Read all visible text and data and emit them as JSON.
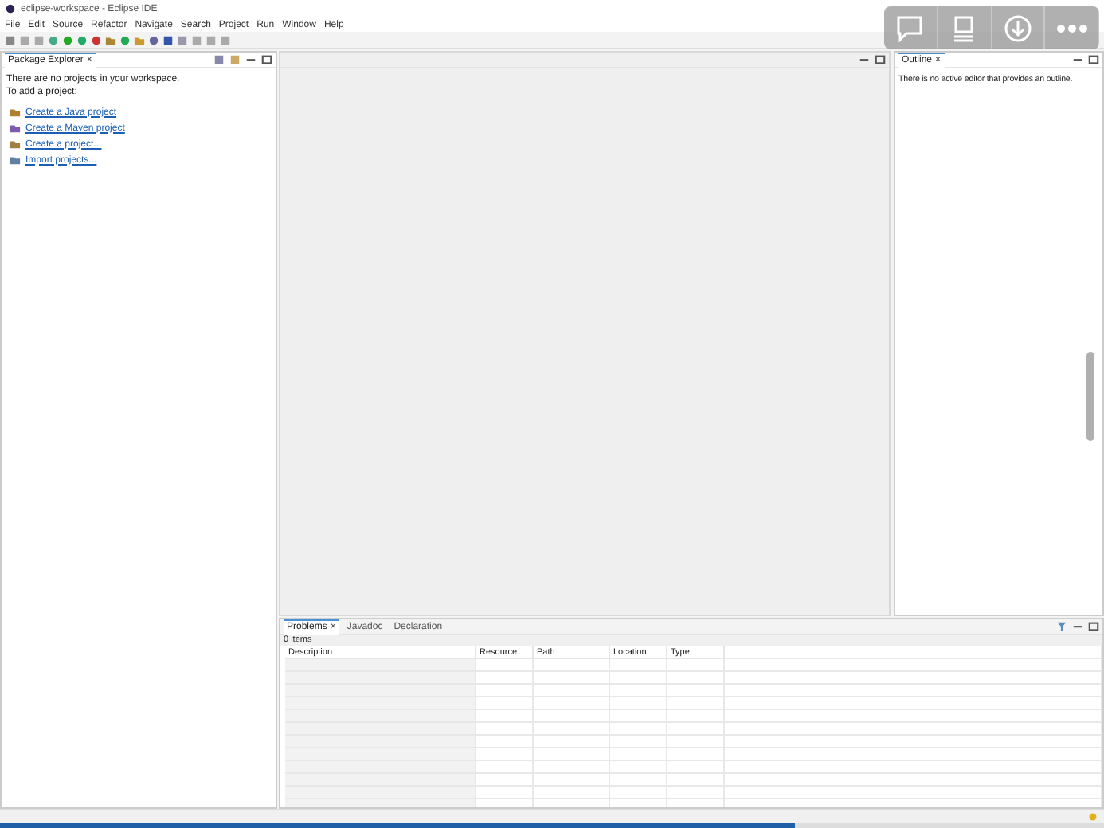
{
  "window": {
    "title": "eclipse-workspace - Eclipse IDE"
  },
  "menu": [
    "File",
    "Edit",
    "Source",
    "Refactor",
    "Navigate",
    "Search",
    "Project",
    "Run",
    "Window",
    "Help"
  ],
  "package_explorer": {
    "tab": "Package Explorer",
    "close": "×",
    "message": [
      "There are no projects in your workspace.",
      "To add a project:"
    ],
    "links": [
      "Create a Java project",
      "Create a Maven project",
      "Create a project...",
      "Import projects..."
    ]
  },
  "outline": {
    "tab": "Outline",
    "close": "×",
    "message": "There is no active editor that provides an outline."
  },
  "bottom_panel": {
    "tabs": [
      {
        "label": "Problems",
        "selected": true,
        "close": "×"
      },
      {
        "label": "Javadoc",
        "selected": false
      },
      {
        "label": "Declaration",
        "selected": false
      }
    ],
    "count": "0 items",
    "columns": [
      "Description",
      "Resource",
      "Path",
      "Location",
      "Type"
    ]
  },
  "progress": {
    "level": 0.72
  }
}
